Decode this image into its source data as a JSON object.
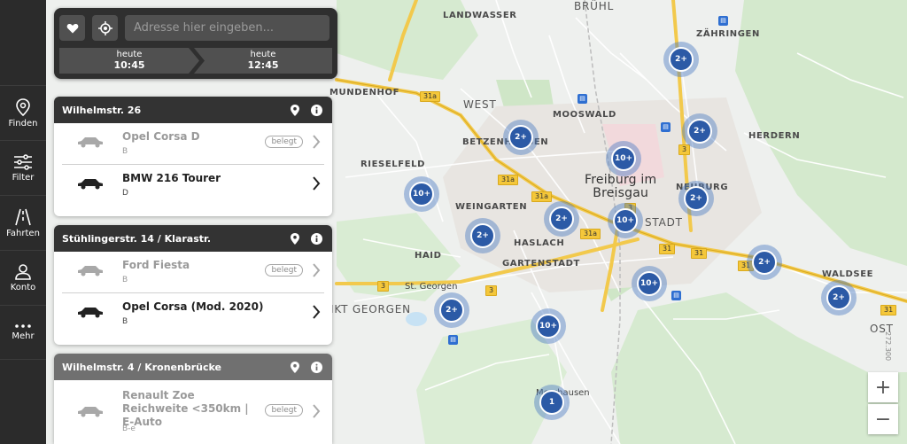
{
  "sidebar": {
    "items": [
      {
        "label": "Finden",
        "icon": "map-pin-icon"
      },
      {
        "label": "Filter",
        "icon": "sliders-icon"
      },
      {
        "label": "Fahrten",
        "icon": "road-icon"
      },
      {
        "label": "Konto",
        "icon": "user-icon"
      },
      {
        "label": "Mehr",
        "icon": "more-dots-icon"
      }
    ]
  },
  "search": {
    "placeholder": "Adresse hier eingeben...",
    "from": {
      "day": "heute",
      "time": "10:45"
    },
    "to": {
      "day": "heute",
      "time": "12:45"
    }
  },
  "stations": [
    {
      "name": "Wilhelmstr. 26",
      "cars": [
        {
          "name": "Opel Corsa D",
          "class": "B",
          "status": "belegt",
          "available": false
        },
        {
          "name": "BMW 216 Tourer",
          "class": "D",
          "status": "",
          "available": true
        }
      ]
    },
    {
      "name": "Stühlingerstr. 14 / Klarastr.",
      "cars": [
        {
          "name": "Ford Fiesta",
          "class": "B",
          "status": "belegt",
          "available": false
        },
        {
          "name": "Opel Corsa (Mod. 2020)",
          "class": "B",
          "status": "",
          "available": true
        }
      ]
    },
    {
      "name": "Wilhelmstr. 4 / Kronenbrücke",
      "cars": [
        {
          "name": "Renault Zoe Reichweite <350km | E-Auto",
          "class": "B-e",
          "status": "belegt",
          "available": false
        }
      ]
    }
  ],
  "map": {
    "places": {
      "bruhl": "BRÜHL",
      "landwasser": "LANDWASSER",
      "zahringen": "ZÄHRINGEN",
      "mundenhof": "MUNDENHOF",
      "west": "WEST",
      "mooswald": "MOOSWALD",
      "betzenhausen": "BETZENHAUSEN",
      "herdern": "HERDERN",
      "rieselfeld": "RIESELFELD",
      "freiburg_line1": "Freiburg im",
      "freiburg_line2": "Breisgau",
      "neuburg": "NEUBURG",
      "weingarten": "WEINGARTEN",
      "altstadt": "STADT",
      "haslach": "HASLACH",
      "haid": "HAID",
      "gartenstadt": "GARTENSTADT",
      "st_georgen_town": "St. Georgen",
      "st_georgen": "IKT GEORGEN",
      "waldsee": "WALDSEE",
      "ost": "OST",
      "merzhausen": "Merzhausen"
    },
    "roads": [
      "31a",
      "31a",
      "31a",
      "31a",
      "31",
      "31",
      "31",
      "3",
      "3",
      "3",
      "3",
      "31"
    ],
    "clusters": [
      "2+",
      "2+",
      "2+",
      "10+",
      "10+",
      "2+",
      "2+",
      "10+",
      "2+",
      "2+",
      "10+",
      "2+",
      "2+",
      "10+",
      "1"
    ],
    "zoom_in": "+",
    "zoom_out": "−",
    "attribution": "272.300"
  },
  "colors": {
    "sidebar_bg": "#2b2b2b",
    "cluster_blue": "#2c5aa6",
    "highway": "#f4c73a"
  }
}
